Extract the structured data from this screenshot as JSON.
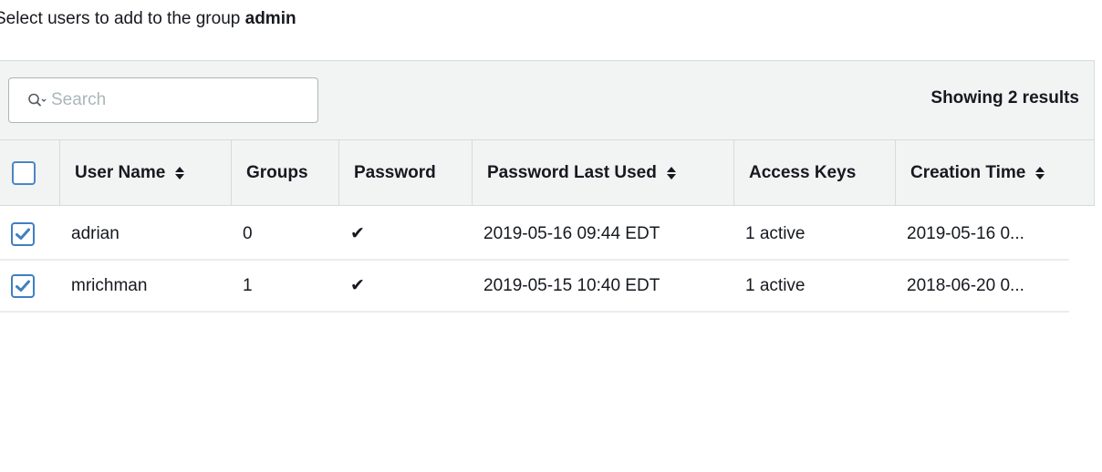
{
  "intro": {
    "prefix": "Select users to add to the group ",
    "group_name": "admin"
  },
  "search": {
    "placeholder": "Search",
    "icon": "search-icon"
  },
  "results_label": "Showing 2 results",
  "columns": [
    {
      "label": "User Name",
      "sortable": true
    },
    {
      "label": "Groups",
      "sortable": false
    },
    {
      "label": "Password",
      "sortable": false
    },
    {
      "label": "Password Last Used",
      "sortable": true
    },
    {
      "label": "Access Keys",
      "sortable": false
    },
    {
      "label": "Creation Time",
      "sortable": true
    }
  ],
  "select_all_checked": false,
  "rows": [
    {
      "checked": true,
      "user_name": "adrian",
      "groups": "0",
      "password": "✔",
      "password_last_used": "2019-05-16 09:44 EDT",
      "access_keys": "1 active",
      "creation_time": "2019-05-16 0..."
    },
    {
      "checked": true,
      "user_name": "mrichman",
      "groups": "1",
      "password": "✔",
      "password_last_used": "2019-05-15 10:40 EDT",
      "access_keys": "1 active",
      "creation_time": "2018-06-20 0..."
    }
  ],
  "colors": {
    "accent": "#4a86c5",
    "header_bg": "#f2f3f3",
    "border": "#d5dbdb",
    "text": "#16191f",
    "placeholder": "#aab7b8"
  }
}
